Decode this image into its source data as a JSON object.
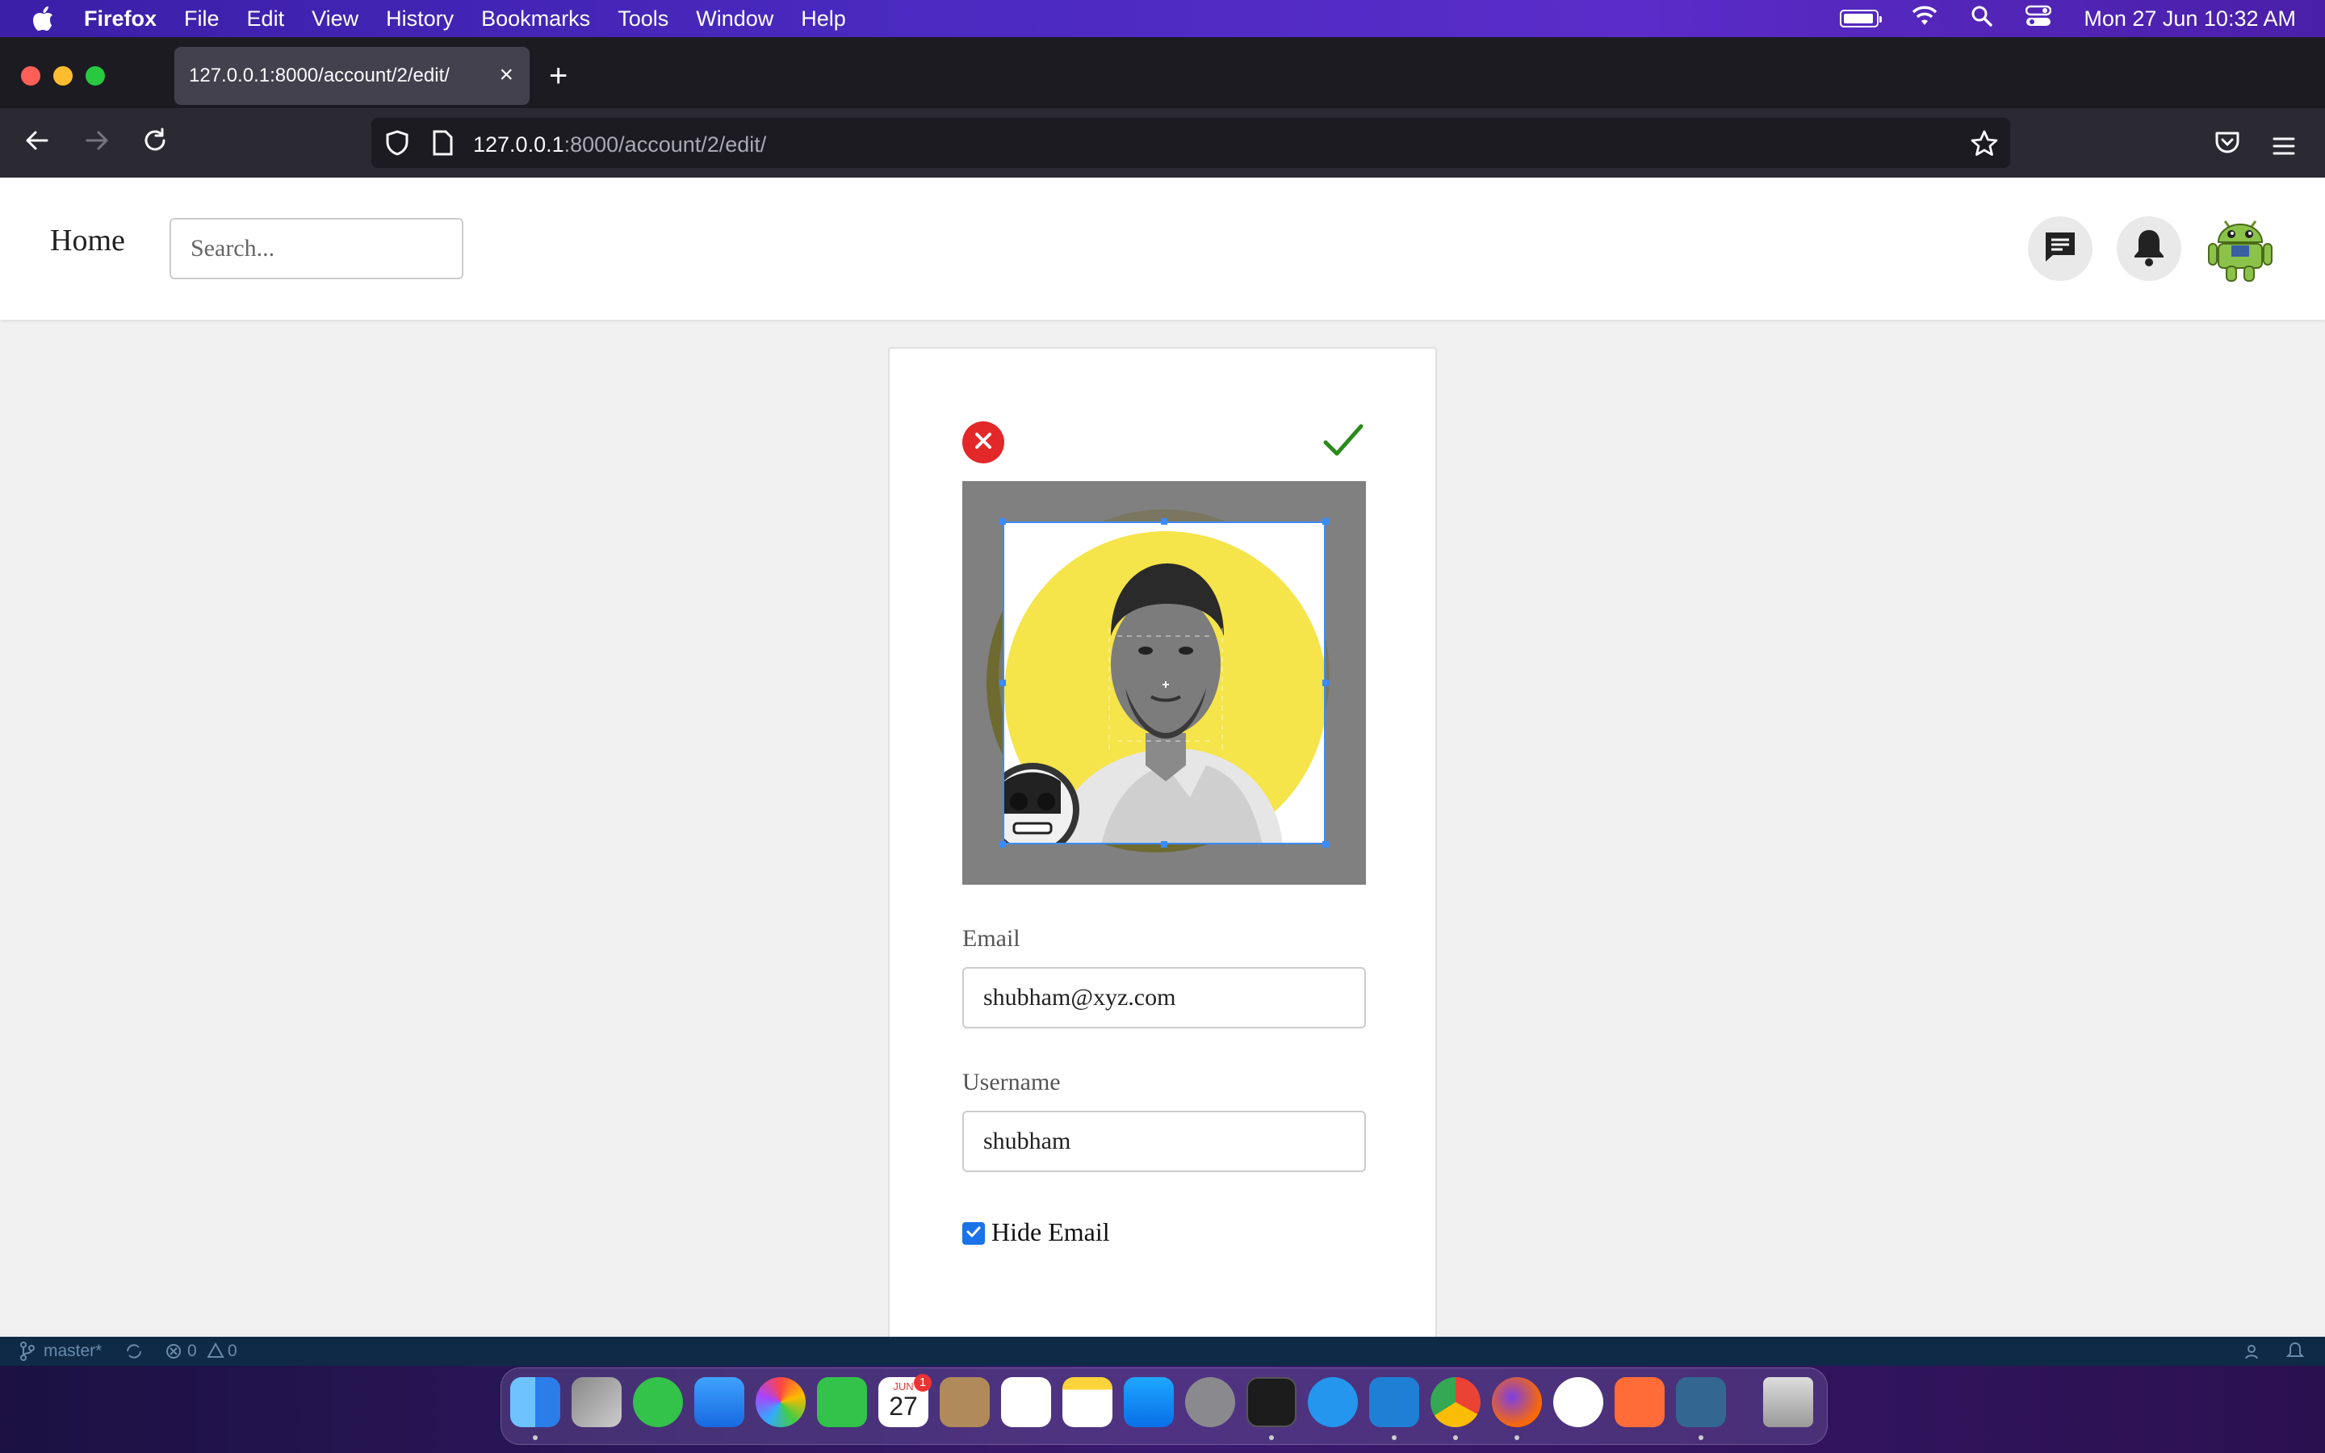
{
  "menubar": {
    "app_name": "Firefox",
    "items": [
      "File",
      "Edit",
      "View",
      "History",
      "Bookmarks",
      "Tools",
      "Window",
      "Help"
    ],
    "clock": "Mon 27 Jun  10:32 AM"
  },
  "browser": {
    "tab_title": "127.0.0.1:8000/account/2/edit/",
    "tab_close": "×",
    "new_tab": "+",
    "url_host": "127.0.0.1",
    "url_rest": ":8000/account/2/edit/"
  },
  "site": {
    "home_label": "Home",
    "search_placeholder": "Search..."
  },
  "form": {
    "email_label": "Email",
    "email_value": "shubham@xyz.com",
    "username_label": "Username",
    "username_value": "shubham",
    "hide_email_label": "Hide Email",
    "hide_email_checked": true
  },
  "statusbar": {
    "branch": "master*",
    "errors": "0",
    "warnings": "0"
  },
  "dock": {
    "calendar_month": "JUN",
    "calendar_day": "27",
    "calendar_badge": "1"
  },
  "colors": {
    "cancel": "#e3282a",
    "confirm": "#2a8a1a",
    "crop_border": "#3a8bff",
    "checkbox": "#1a73e8"
  }
}
